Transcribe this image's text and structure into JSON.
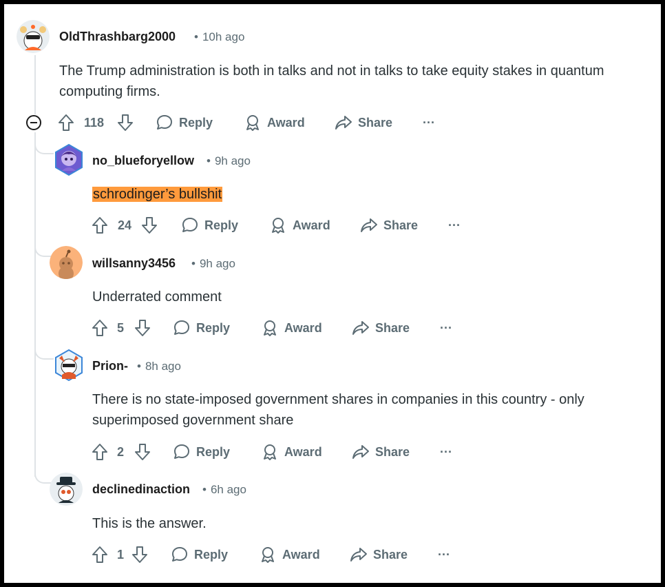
{
  "comments": [
    {
      "username": "OldThrashbarg2000",
      "time": "10h ago",
      "body": "The Trump administration is both in talks and not in talks to take equity stakes in quantum computing firms.",
      "votes": "118",
      "reply": "Reply",
      "award": "Award",
      "share": "Share",
      "more": "···"
    },
    {
      "username": "no_blueforyellow",
      "time": "9h ago",
      "body": "schrodinger’s bullshit",
      "votes": "24",
      "reply": "Reply",
      "award": "Award",
      "share": "Share",
      "more": "···"
    },
    {
      "username": "willsanny3456",
      "time": "9h ago",
      "body": "Underrated comment",
      "votes": "5",
      "reply": "Reply",
      "award": "Award",
      "share": "Share",
      "more": "···"
    },
    {
      "username": "Prion-",
      "time": "8h ago",
      "body": "There is no state-imposed government shares in companies in this country - only superimposed government share",
      "votes": "2",
      "reply": "Reply",
      "award": "Award",
      "share": "Share",
      "more": "···"
    },
    {
      "username": "declinedinaction",
      "time": "6h ago",
      "body": "This is the answer.",
      "votes": "1",
      "reply": "Reply",
      "award": "Award",
      "share": "Share",
      "more": "···"
    }
  ],
  "colors": {
    "highlight": "#ff9a3c",
    "meta_text": "#5c6c74",
    "thread_line": "#dfe3e6"
  },
  "icons": [
    "collapse-icon",
    "upvote-icon",
    "downvote-icon",
    "reply-icon",
    "award-icon",
    "share-icon",
    "more-icon"
  ]
}
